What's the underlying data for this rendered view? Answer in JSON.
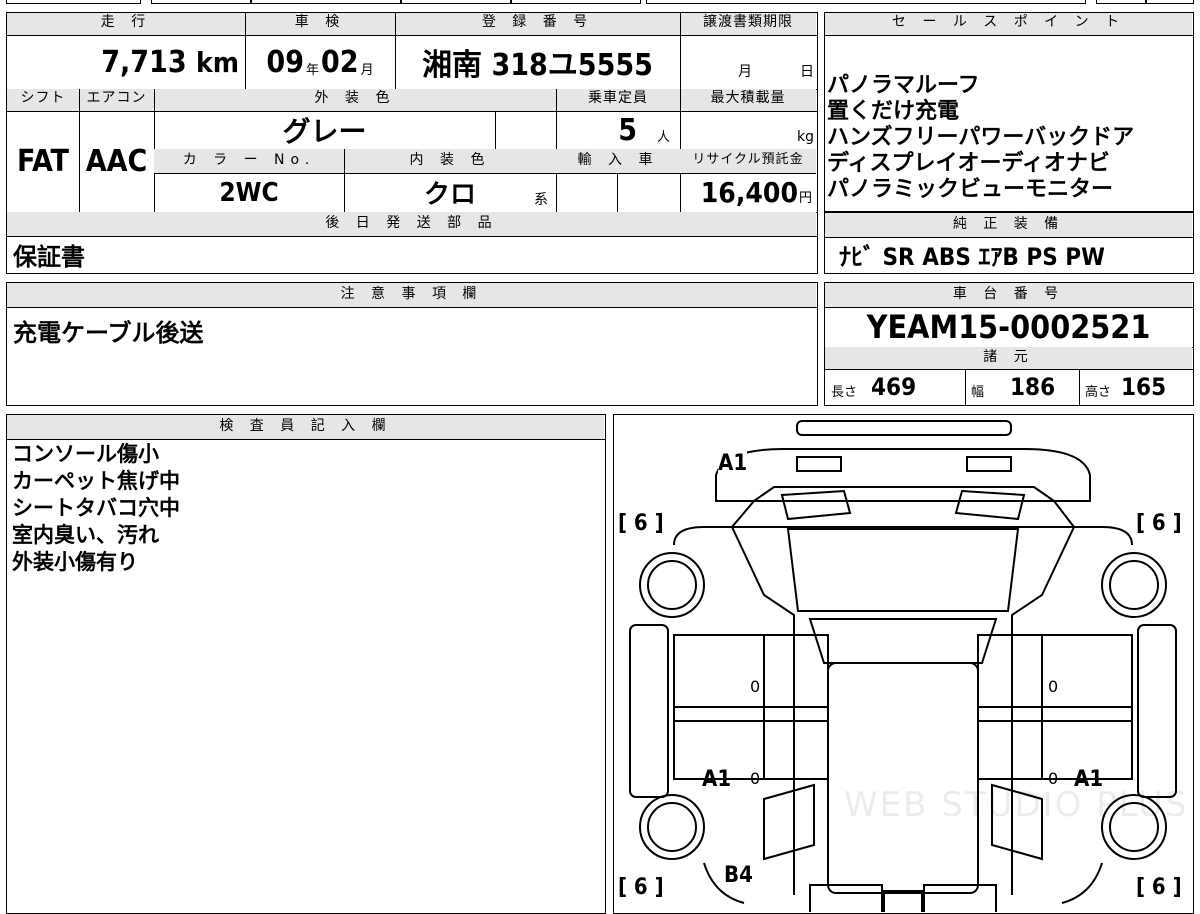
{
  "top_row": {
    "mileage": {
      "label": "走 行",
      "value": "7,713",
      "unit": "km"
    },
    "inspection": {
      "label": "車 検",
      "year": "09",
      "year_unit": "年",
      "month": "02",
      "month_unit": "月"
    },
    "registration": {
      "label": "登 録 番 号",
      "value": "湘南 318ユ5555"
    },
    "transfer_deadline": {
      "label": "譲渡書類期限",
      "month_unit": "月",
      "day_unit": "日"
    }
  },
  "mid_row": {
    "shift": {
      "label": "シフト",
      "value": "FAT"
    },
    "aircon": {
      "label": "エアコン",
      "value": "AAC"
    },
    "exterior_color": {
      "label": "外 装 色",
      "value": "グレー"
    },
    "capacity": {
      "label": "乗車定員",
      "value": "5",
      "unit": "人"
    },
    "max_load": {
      "label": "最大積載量",
      "value": "",
      "unit": "kg"
    },
    "color_no": {
      "label": "カ ラ ー No.",
      "value": "2WC"
    },
    "interior_color": {
      "label": "内 装 色",
      "value": "クロ",
      "suffix": "系"
    },
    "import": {
      "label": "輸 入 車"
    },
    "recycle": {
      "label": "リサイクル預託金",
      "value": "16,400",
      "unit": "円"
    }
  },
  "later_parts": {
    "label": "後 日 発 送 部 品",
    "value": "保証書"
  },
  "sales_points": {
    "label": "セ ー ル ス ポ イ ン ト",
    "items": [
      "パノラマルーフ",
      "置くだけ充電",
      "ハンズフリーパワーバックドア",
      "ディスプレイオーディオナビ",
      "パノラミックビューモニター"
    ]
  },
  "genuine_equipment": {
    "label": "純 正 装 備",
    "value": "ﾅﾋﾞ SR ABS ｴｱB PS PW"
  },
  "notes": {
    "label": "注 意 事 項 欄",
    "value": "充電ケーブル後送"
  },
  "chassis": {
    "label": "車 台 番 号",
    "value": "YEAM15-0002521"
  },
  "specs": {
    "label": "諸 元",
    "length_label": "長さ",
    "length": "469",
    "width_label": "幅",
    "width": "186",
    "height_label": "高さ",
    "height": "165"
  },
  "inspector": {
    "label": "検 査 員 記 入 欄",
    "lines": [
      "コンソール傷小",
      "カーペット焦げ中",
      "シートタバコ穴中",
      "室内臭い、汚れ",
      "外装小傷有り"
    ]
  },
  "diagram": {
    "tire_marks": [
      "[ 6 ]",
      "[ 6 ]",
      "[ 6 ]",
      "[ 6 ]"
    ],
    "damage_marks": [
      "A1",
      "A1",
      "A1",
      "B4"
    ],
    "door_zeros": [
      "0",
      "0",
      "0",
      "0"
    ],
    "watermark": "WEB STUDIO PLUS"
  }
}
